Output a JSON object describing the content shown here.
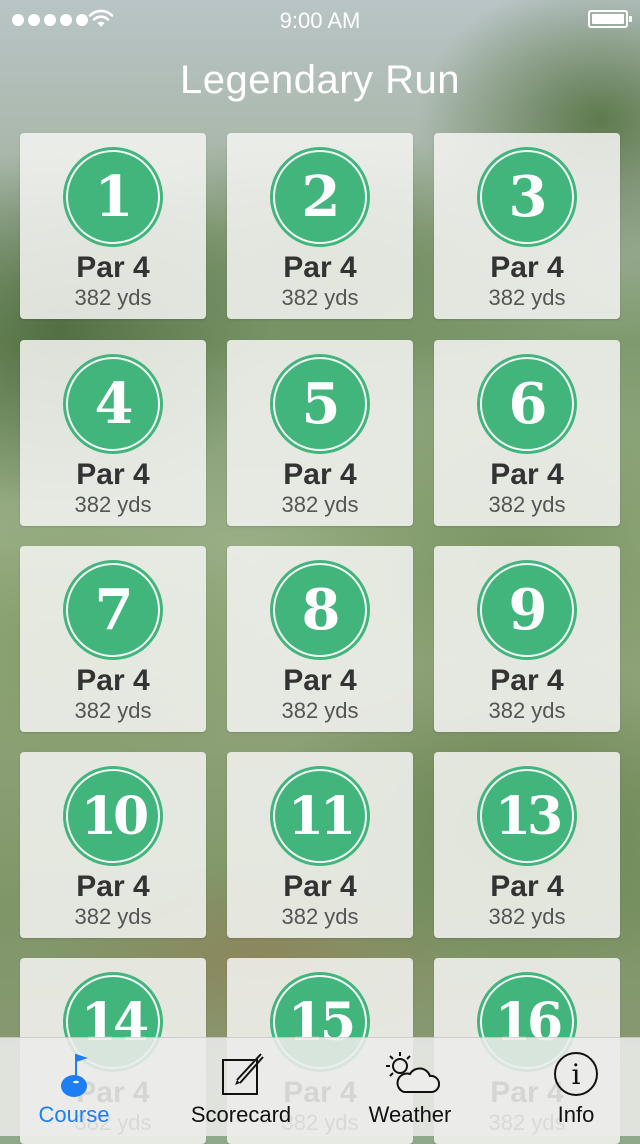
{
  "status_bar": {
    "time": "9:00 AM"
  },
  "title": "Legendary Run",
  "holes": [
    {
      "number": "1",
      "par": "Par 4",
      "yards": "382 yds"
    },
    {
      "number": "2",
      "par": "Par 4",
      "yards": "382 yds"
    },
    {
      "number": "3",
      "par": "Par 4",
      "yards": "382 yds"
    },
    {
      "number": "4",
      "par": "Par 4",
      "yards": "382 yds"
    },
    {
      "number": "5",
      "par": "Par 4",
      "yards": "382 yds"
    },
    {
      "number": "6",
      "par": "Par 4",
      "yards": "382 yds"
    },
    {
      "number": "7",
      "par": "Par 4",
      "yards": "382 yds"
    },
    {
      "number": "8",
      "par": "Par 4",
      "yards": "382 yds"
    },
    {
      "number": "9",
      "par": "Par 4",
      "yards": "382 yds"
    },
    {
      "number": "10",
      "par": "Par 4",
      "yards": "382 yds"
    },
    {
      "number": "11",
      "par": "Par 4",
      "yards": "382 yds"
    },
    {
      "number": "13",
      "par": "Par 4",
      "yards": "382 yds"
    },
    {
      "number": "14",
      "par": "Par 4",
      "yards": "382 yds"
    },
    {
      "number": "15",
      "par": "Par 4",
      "yards": "382 yds"
    },
    {
      "number": "16",
      "par": "Par 4",
      "yards": "382 yds"
    }
  ],
  "tabs": [
    {
      "label": "Course",
      "icon": "golf-flag-icon",
      "active": true
    },
    {
      "label": "Scorecard",
      "icon": "edit-icon",
      "active": false
    },
    {
      "label": "Weather",
      "icon": "weather-icon",
      "active": false
    },
    {
      "label": "Info",
      "icon": "info-icon",
      "active": false
    }
  ],
  "colors": {
    "badge_green": "#42b57c",
    "tab_active": "#1e7ff5"
  }
}
